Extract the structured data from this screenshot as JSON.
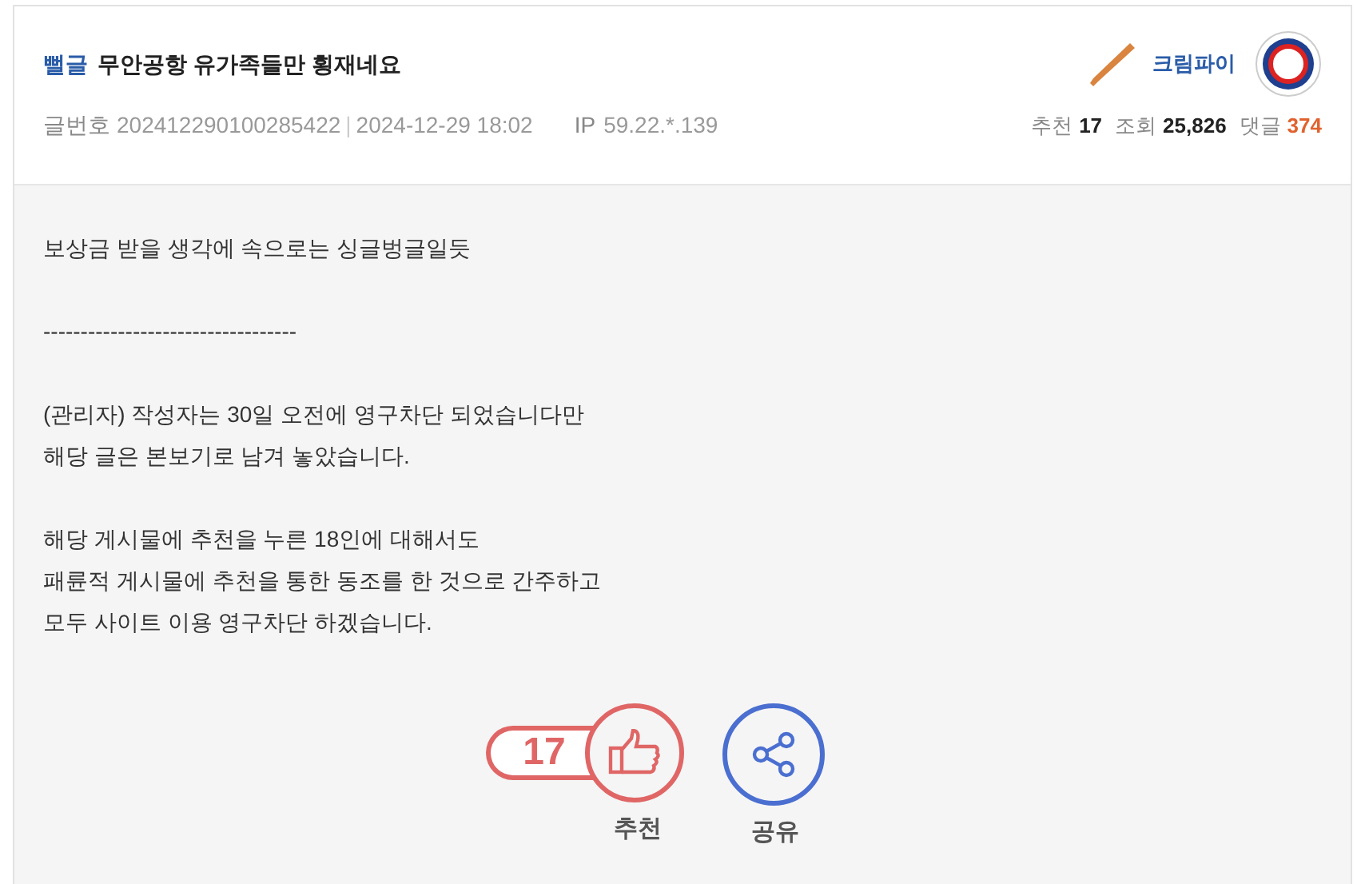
{
  "post": {
    "tag": "뻘글",
    "title": "무안공항 유가족들만 횡재네요",
    "author": "크림파이",
    "number_label": "글번호",
    "number": "202412290100285422",
    "separator": "|",
    "date": "2024-12-29 18:02",
    "ip_label": "IP",
    "ip": "59.22.*.139",
    "stats": [
      {
        "label": "추천",
        "value": "17",
        "kind": "plain"
      },
      {
        "label": "조회",
        "value": "25,826",
        "kind": "plain"
      },
      {
        "label": "댓글",
        "value": "374",
        "kind": "accent"
      }
    ]
  },
  "body": [
    {
      "lines": [
        "보상금 받을 생각에 속으로는 싱글벙글일듯"
      ]
    },
    {
      "lines": [
        "----------------------------------"
      ]
    },
    {
      "lines": [
        "(관리자) 작성자는 30일 오전에 영구차단 되었습니다만",
        "해당 글은 본보기로 남겨 놓았습니다."
      ]
    },
    {
      "lines": [
        "해당 게시물에 추천을 누른 18인에 대해서도",
        "패륜적 게시물에 추천을 통한 동조를 한 것으로 간주하고",
        "모두 사이트 이용 영구차단 하겠습니다."
      ]
    }
  ],
  "actions": [
    {
      "kind": "recommend",
      "count": "17",
      "label": "추천"
    },
    {
      "kind": "share",
      "label": "공유"
    }
  ]
}
